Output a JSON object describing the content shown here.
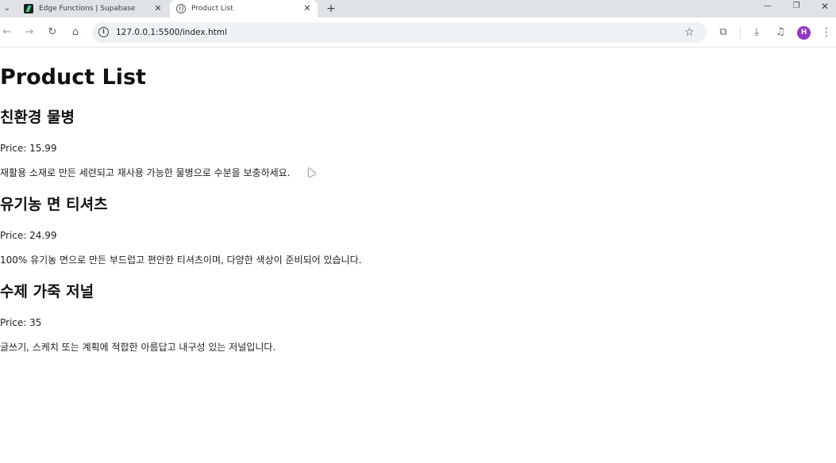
{
  "browser": {
    "tabs": [
      {
        "title": "Edge Functions | Supabase",
        "favicon": "supabase-icon",
        "active": false
      },
      {
        "title": "Product List",
        "favicon": "globe-icon",
        "active": true
      }
    ],
    "new_tab_label": "+",
    "address": "127.0.0.1:5500/index.html",
    "profile_initial": "H",
    "profile_color": "#9334c6"
  },
  "page": {
    "title": "Product List",
    "products": [
      {
        "name": "친환경 물병",
        "price": "Price: 15.99",
        "description": "재활용 소재로 만든 세련되고 재사용 가능한 물병으로 수분을 보충하세요."
      },
      {
        "name": "유기농 면 티셔츠",
        "price": "Price: 24.99",
        "description": "100% 유기농 면으로 만든 부드럽고 편안한 티셔츠이며, 다양한 색상이 준비되어 있습니다."
      },
      {
        "name": "수제 가죽 저널",
        "price": "Price: 35",
        "description": "글쓰기, 스케치 또는 계획에 적합한 아름답고 내구성 있는 저널입니다."
      }
    ]
  }
}
